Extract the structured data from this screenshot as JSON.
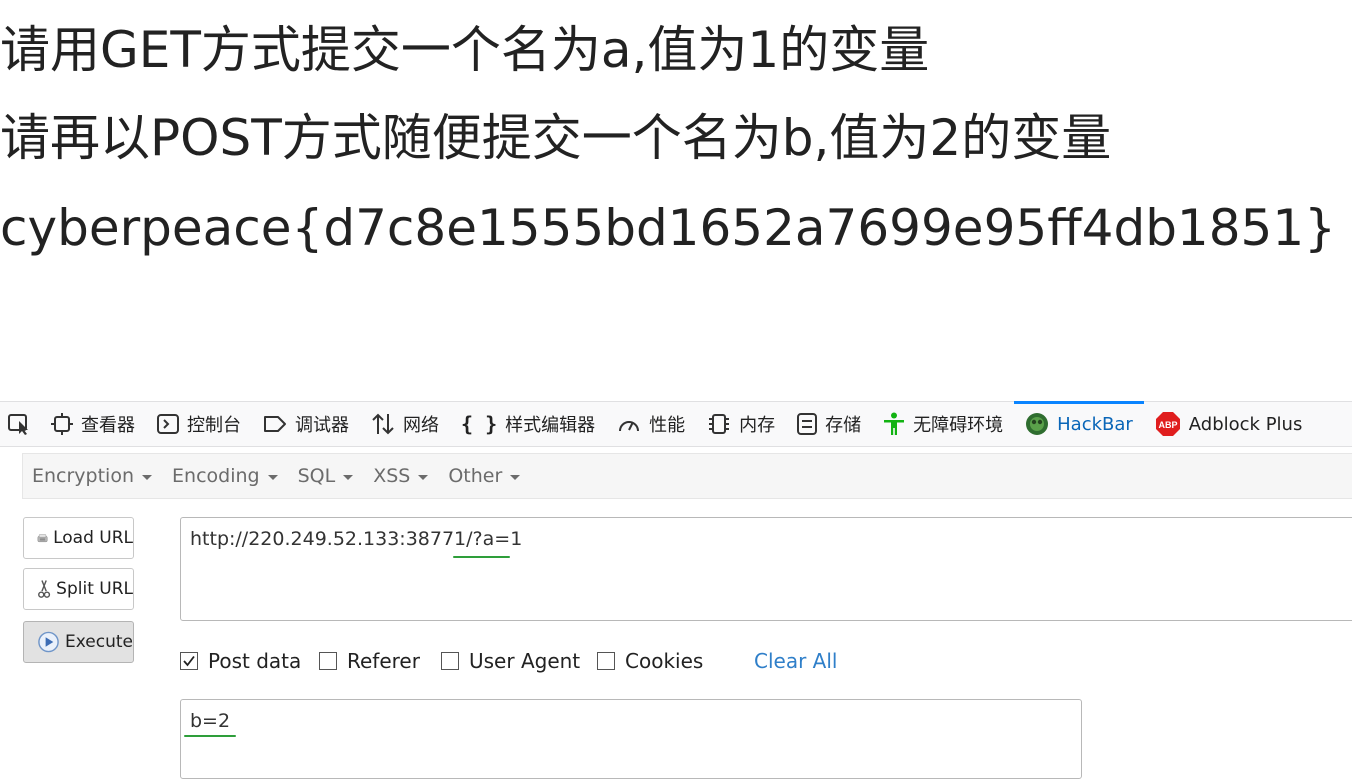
{
  "page": {
    "line1": "请用GET方式提交一个名为a,值为1的变量",
    "line2": "请再以POST方式随便提交一个名为b,值为2的变量",
    "flag": "cyberpeace{d7c8e1555bd1652a7699e95ff4db1851}"
  },
  "devtools": {
    "tabs": [
      {
        "label": "查看器",
        "icon": "inspector-icon"
      },
      {
        "label": "控制台",
        "icon": "console-icon"
      },
      {
        "label": "调试器",
        "icon": "debugger-icon"
      },
      {
        "label": "网络",
        "icon": "network-icon"
      },
      {
        "label": "样式编辑器",
        "icon": "style-editor-icon"
      },
      {
        "label": "性能",
        "icon": "performance-icon"
      },
      {
        "label": "内存",
        "icon": "memory-icon"
      },
      {
        "label": "存储",
        "icon": "storage-icon"
      },
      {
        "label": "无障碍环境",
        "icon": "accessibility-icon"
      },
      {
        "label": "HackBar",
        "icon": "hackbar-icon",
        "active": true
      },
      {
        "label": "Adblock Plus",
        "icon": "adblock-icon"
      }
    ],
    "adblock_badge": "ABP",
    "accent_color": "#0a84ff"
  },
  "hackbar": {
    "menu": [
      "Encryption",
      "Encoding",
      "SQL",
      "XSS",
      "Other"
    ],
    "buttons": {
      "load": "Load URL",
      "split": "Split URL",
      "execute": "Execute"
    },
    "url_value": "http://220.249.52.133:38771/?a=1",
    "options": {
      "post_data": "Post data",
      "post_data_checked": true,
      "referer": "Referer",
      "referer_checked": false,
      "user_agent": "User Agent",
      "user_agent_checked": false,
      "cookies": "Cookies",
      "cookies_checked": false
    },
    "clear_all": "Clear All",
    "post_value": "b=2",
    "highlight_color": "#2e9e3a"
  }
}
